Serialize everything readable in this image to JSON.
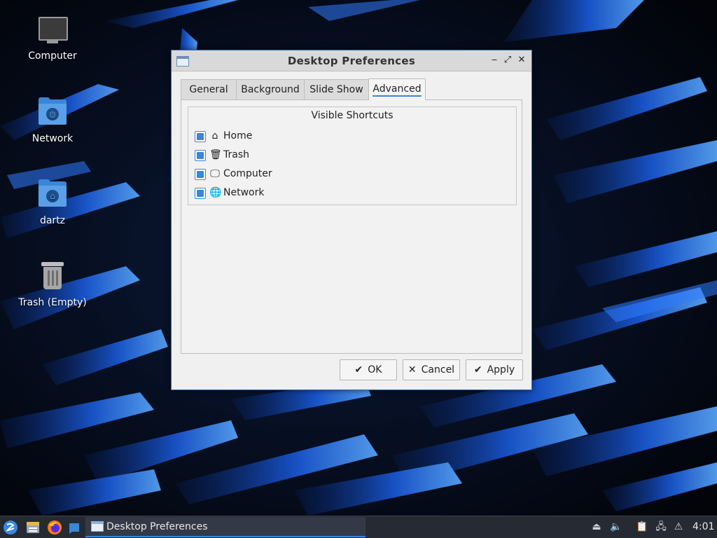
{
  "desktop": {
    "icons": [
      {
        "label": "Computer",
        "icon": "computer-icon"
      },
      {
        "label": "Network",
        "icon": "network-folder-icon"
      },
      {
        "label": "dartz",
        "icon": "home-folder-icon"
      },
      {
        "label": "Trash (Empty)",
        "icon": "trash-icon"
      }
    ]
  },
  "dialog": {
    "title": "Desktop Preferences",
    "controls": {
      "minimize": "‒",
      "maximize": "⤢",
      "close": "✕"
    },
    "tabs": [
      {
        "label": "General",
        "active": false
      },
      {
        "label": "Background",
        "active": false
      },
      {
        "label": "Slide Show",
        "active": false
      },
      {
        "label": "Advanced",
        "active": true
      }
    ],
    "section_title": "Visible Shortcuts",
    "shortcuts": [
      {
        "label": "Home",
        "checked": true,
        "icon": "home-icon",
        "glyph": "⌂"
      },
      {
        "label": "Trash",
        "checked": true,
        "icon": "trash-icon",
        "glyph": "🗑"
      },
      {
        "label": "Computer",
        "checked": true,
        "icon": "monitor-icon",
        "glyph": "🖵"
      },
      {
        "label": "Network",
        "checked": true,
        "icon": "globe-icon",
        "glyph": "🌐"
      }
    ],
    "buttons": {
      "ok": {
        "label": "OK",
        "glyph": "✔"
      },
      "cancel": {
        "label": "Cancel",
        "glyph": "✕"
      },
      "apply": {
        "label": "Apply",
        "glyph": "✔"
      }
    }
  },
  "taskbar": {
    "task_label": "Desktop Preferences",
    "clock": "4:01"
  },
  "colors": {
    "accent": "#3a86d8",
    "taskbar_bg": "#262a33",
    "dialog_border": "#3a6fb0"
  }
}
